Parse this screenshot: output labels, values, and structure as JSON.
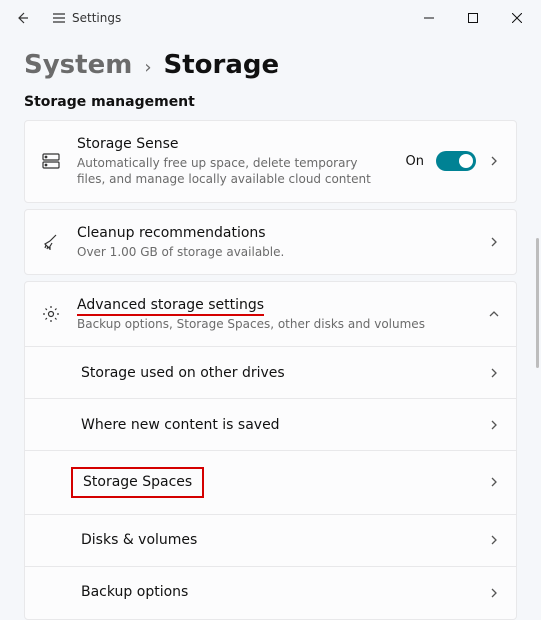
{
  "titlebar": {
    "app_name": "Settings"
  },
  "breadcrumb": {
    "parent": "System",
    "current": "Storage"
  },
  "section_label": "Storage management",
  "storage_sense": {
    "title": "Storage Sense",
    "subtitle": "Automatically free up space, delete temporary files, and manage locally available cloud content",
    "state_label": "On"
  },
  "cleanup": {
    "title": "Cleanup recommendations",
    "subtitle": "Over 1.00 GB of storage available."
  },
  "advanced": {
    "title": "Advanced storage settings",
    "subtitle": "Backup options, Storage Spaces, other disks and volumes",
    "items": [
      {
        "label": "Storage used on other drives"
      },
      {
        "label": "Where new content is saved"
      },
      {
        "label": "Storage Spaces"
      },
      {
        "label": "Disks & volumes"
      },
      {
        "label": "Backup options"
      }
    ]
  }
}
